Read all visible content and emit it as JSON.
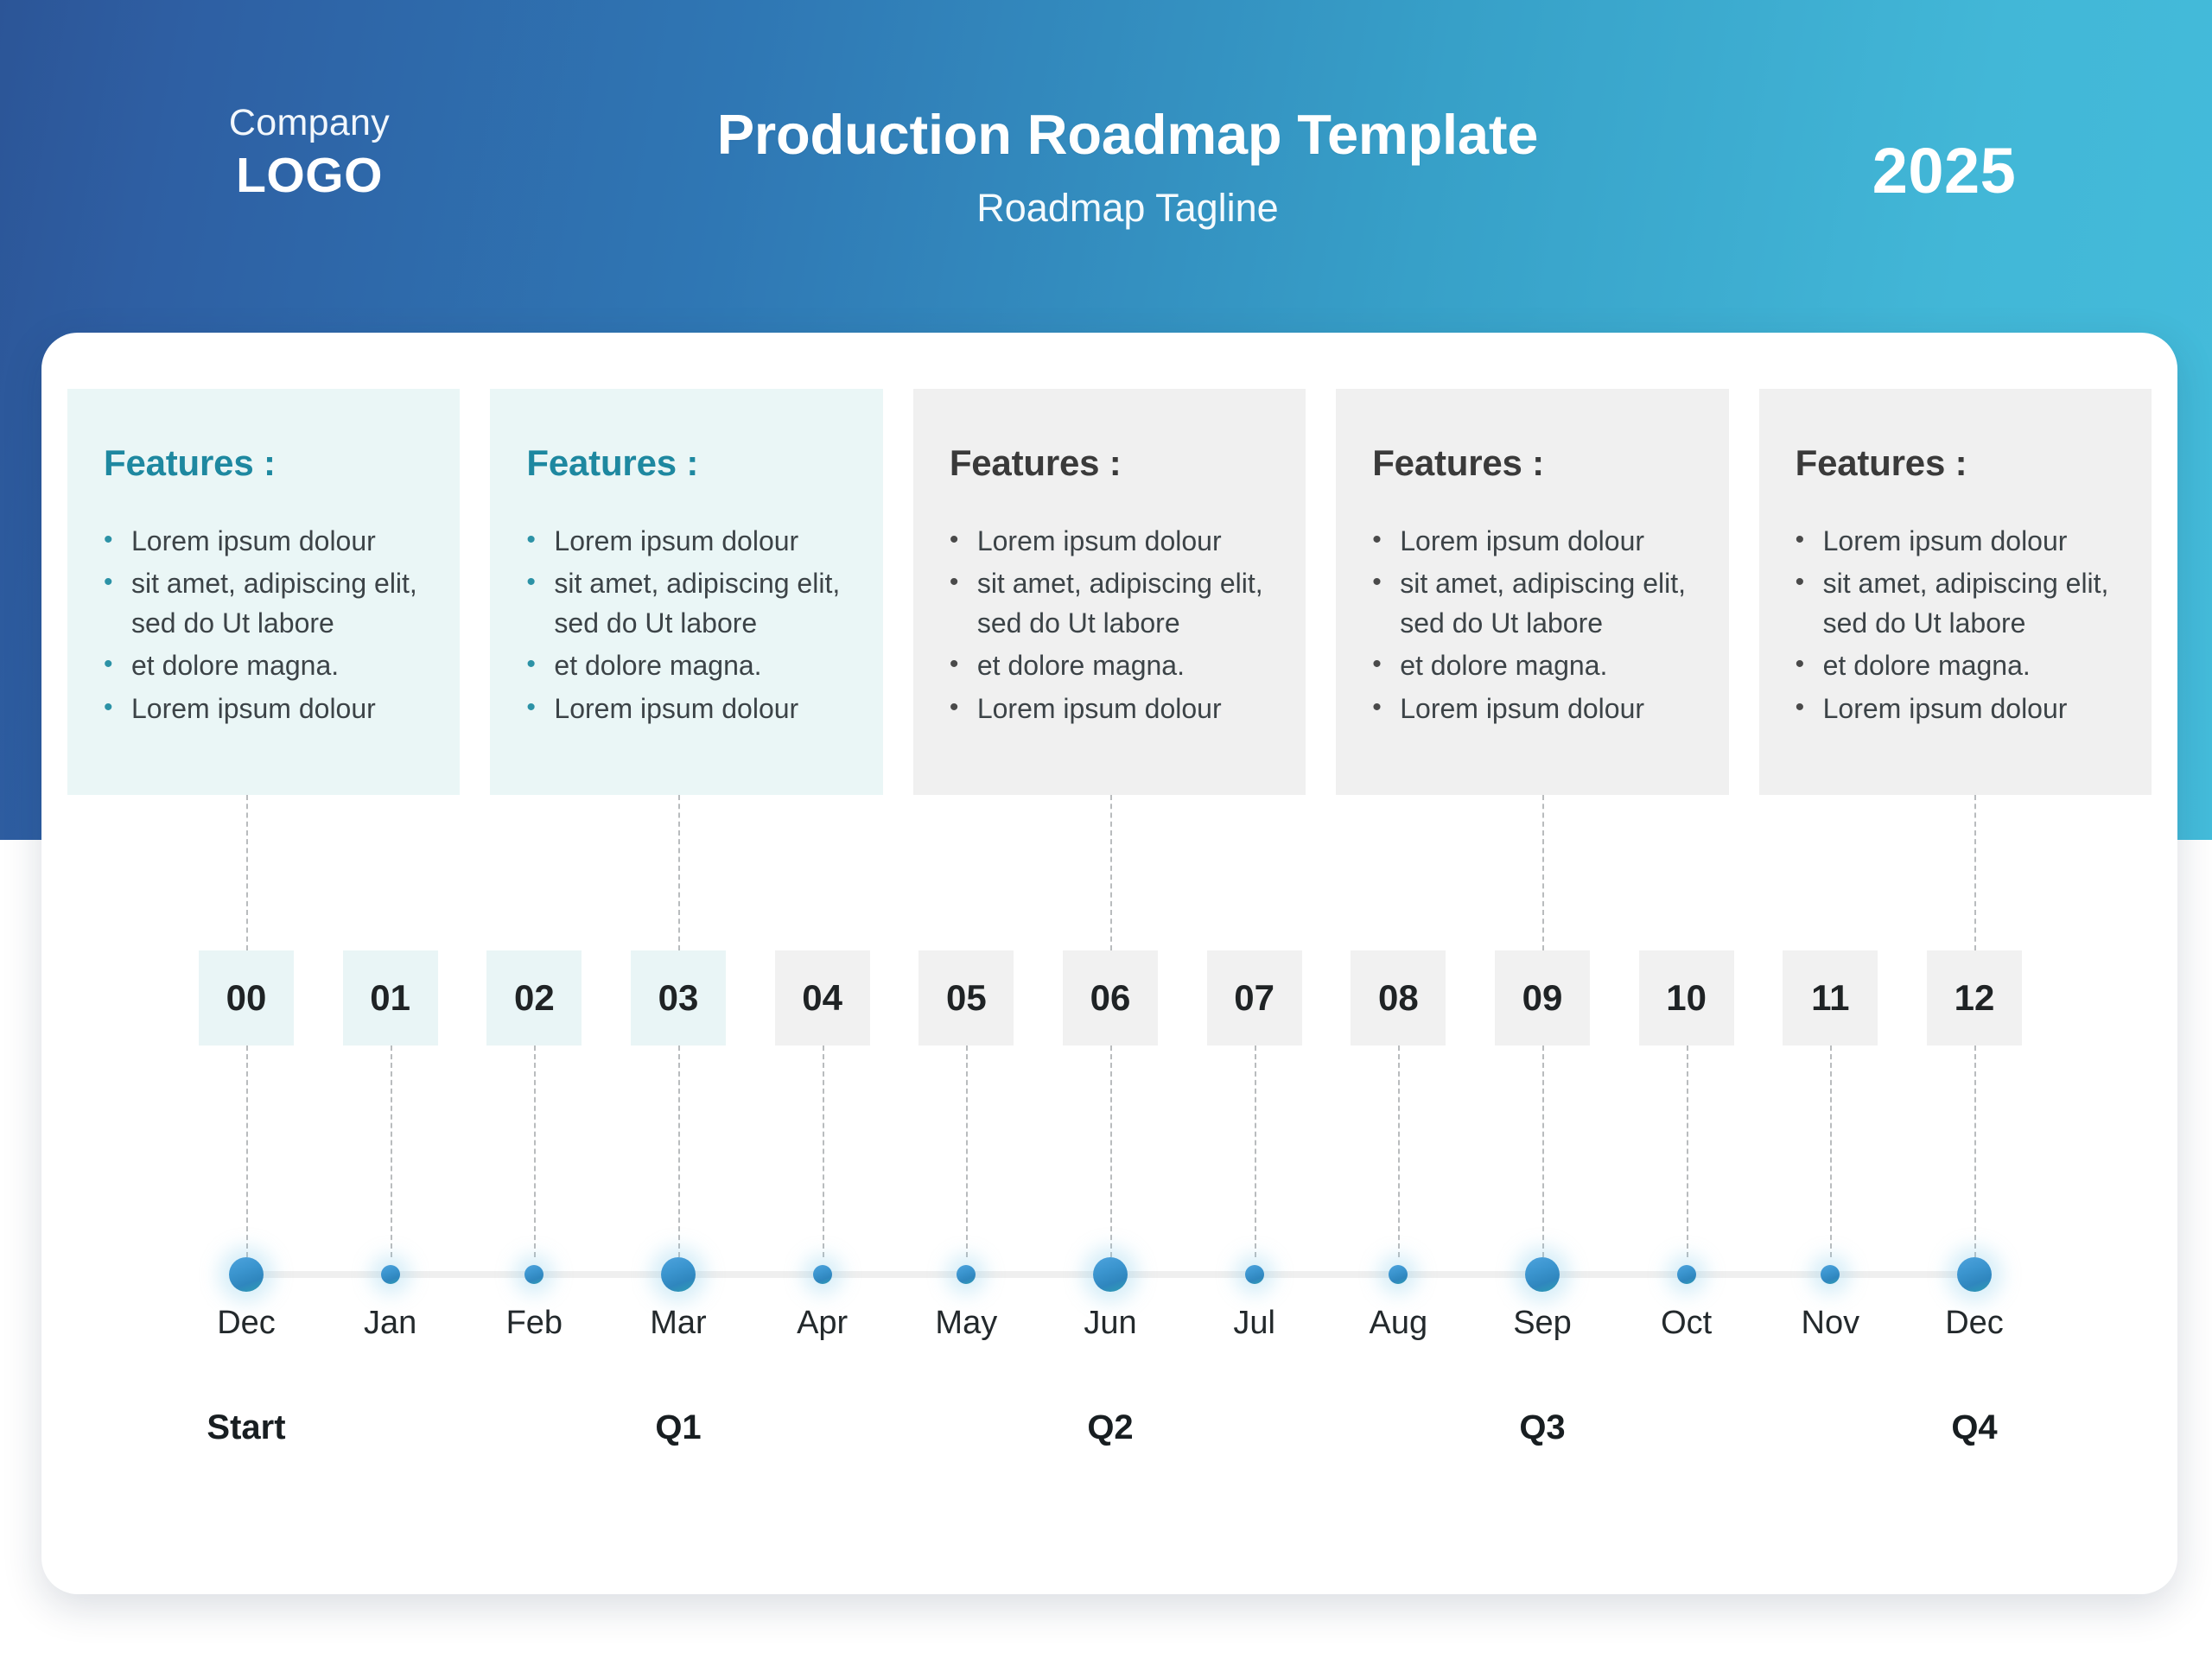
{
  "header": {
    "logo_company": "Company",
    "logo_name": "LOGO",
    "title": "Production Roadmap Template",
    "subtitle": "Roadmap Tagline",
    "year": "2025",
    "gradient_from": "#2c5597",
    "gradient_to": "#44bcdb"
  },
  "cards": [
    {
      "heading": "Features :",
      "theme": "teal",
      "bg": "#eaf6f6",
      "heading_color": "#1e88a0",
      "bullets": [
        "Lorem ipsum dolour",
        "sit amet, adipiscing elit, sed do Ut labore",
        "et dolore magna.",
        "Lorem ipsum dolour"
      ]
    },
    {
      "heading": "Features :",
      "theme": "teal",
      "bg": "#eaf6f6",
      "heading_color": "#1e88a0",
      "bullets": [
        "Lorem ipsum dolour",
        "sit amet, adipiscing elit, sed do Ut labore",
        "et dolore magna.",
        "Lorem ipsum dolour"
      ]
    },
    {
      "heading": "Features :",
      "theme": "gray",
      "bg": "#f0f0f0",
      "heading_color": "#3a3a3a",
      "bullets": [
        "Lorem ipsum dolour",
        "sit amet, adipiscing elit, sed do Ut labore",
        "et dolore magna.",
        "Lorem ipsum dolour"
      ]
    },
    {
      "heading": "Features :",
      "theme": "gray",
      "bg": "#f0f0f0",
      "heading_color": "#3a3a3a",
      "bullets": [
        "Lorem ipsum dolour",
        "sit amet, adipiscing elit, sed do Ut labore",
        "et dolore magna.",
        "Lorem ipsum dolour"
      ]
    },
    {
      "heading": "Features :",
      "theme": "gray",
      "bg": "#f0f0f0",
      "heading_color": "#3a3a3a",
      "bullets": [
        "Lorem ipsum dolour",
        "sit amet, adipiscing elit, sed do Ut labore",
        "et dolore magna.",
        "Lorem ipsum dolour"
      ]
    }
  ],
  "bullet_glyph": "•",
  "timeline": {
    "milestones": [
      {
        "number": "00",
        "month": "Dec",
        "box_theme": "teal",
        "dot": "big"
      },
      {
        "number": "01",
        "month": "Jan",
        "box_theme": "teal",
        "dot": "small"
      },
      {
        "number": "02",
        "month": "Feb",
        "box_theme": "teal",
        "dot": "small"
      },
      {
        "number": "03",
        "month": "Mar",
        "box_theme": "teal",
        "dot": "big"
      },
      {
        "number": "04",
        "month": "Apr",
        "box_theme": "gray",
        "dot": "small"
      },
      {
        "number": "05",
        "month": "May",
        "box_theme": "gray",
        "dot": "small"
      },
      {
        "number": "06",
        "month": "Jun",
        "box_theme": "gray",
        "dot": "big"
      },
      {
        "number": "07",
        "month": "Jul",
        "box_theme": "gray",
        "dot": "small"
      },
      {
        "number": "08",
        "month": "Aug",
        "box_theme": "gray",
        "dot": "small"
      },
      {
        "number": "09",
        "month": "Sep",
        "box_theme": "gray",
        "dot": "big"
      },
      {
        "number": "10",
        "month": "Oct",
        "box_theme": "gray",
        "dot": "small"
      },
      {
        "number": "11",
        "month": "Nov",
        "box_theme": "gray",
        "dot": "small"
      },
      {
        "number": "12",
        "month": "Dec",
        "box_theme": "gray",
        "dot": "big"
      }
    ],
    "quarters": [
      {
        "label": "Start",
        "index": 0
      },
      {
        "label": "Q1",
        "index": 3
      },
      {
        "label": "Q2",
        "index": 6
      },
      {
        "label": "Q3",
        "index": 9
      },
      {
        "label": "Q4",
        "index": 12
      }
    ],
    "dot_color": "#3b95cf",
    "rail_color": "#efefef"
  }
}
